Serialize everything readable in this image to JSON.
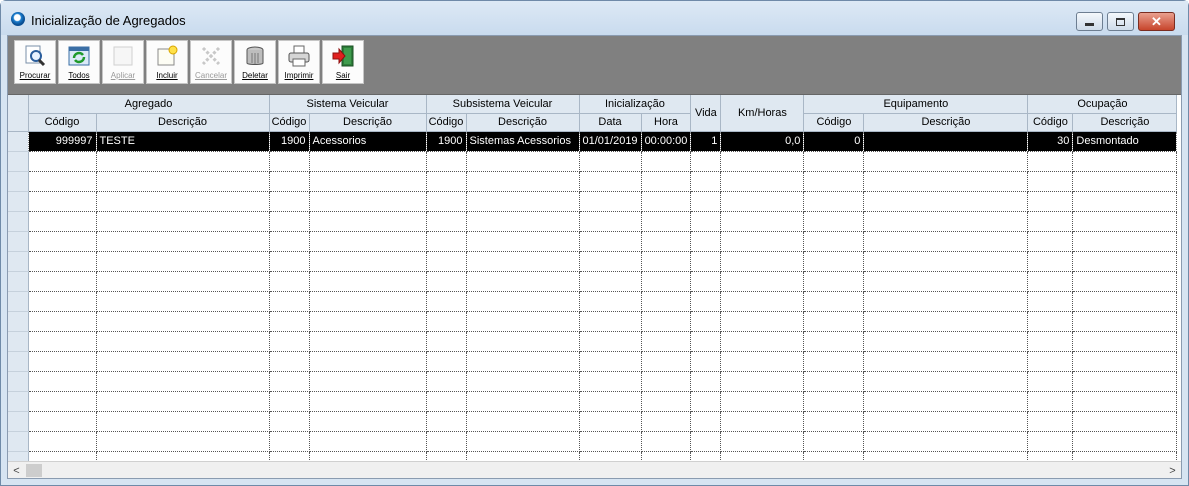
{
  "window": {
    "title": "Inicialização de Agregados"
  },
  "toolbar": {
    "buttons": [
      {
        "label": "Procurar",
        "icon": "magnifier-icon",
        "enabled": true
      },
      {
        "label": "Todos",
        "icon": "refresh-list-icon",
        "enabled": true
      },
      {
        "label": "Aplicar",
        "icon": "apply-icon",
        "enabled": false
      },
      {
        "label": "Incluir",
        "icon": "new-document-icon",
        "enabled": true
      },
      {
        "label": "Cancelar",
        "icon": "cancel-icon",
        "enabled": false
      },
      {
        "label": "Deletar",
        "icon": "trash-can-icon",
        "enabled": true
      },
      {
        "label": "Imprimir",
        "icon": "printer-icon",
        "enabled": true
      },
      {
        "label": "Sair",
        "icon": "exit-door-icon",
        "enabled": true
      }
    ]
  },
  "grid": {
    "groups": {
      "agregado": "Agregado",
      "sistema": "Sistema Veicular",
      "subsistema": "Subsistema Veicular",
      "inicializacao": "Inicialização",
      "vida": "Vida",
      "kmhoras": "Km/Horas",
      "equipamento": "Equipamento",
      "ocupacao": "Ocupação"
    },
    "columns": {
      "codigo": "Código",
      "descricao": "Descrição",
      "data": "Data",
      "hora": "Hora"
    },
    "rows": [
      {
        "ag_codigo": "999997",
        "ag_descricao": "TESTE",
        "sis_codigo": "1900",
        "sis_descricao": "Acessorios",
        "sub_codigo": "1900",
        "sub_descricao": "Sistemas Acessorios",
        "data": "01/01/2019",
        "hora": "00:00:00",
        "vida": "1",
        "kmhoras": "0,0",
        "eq_codigo": "0",
        "eq_descricao": "",
        "oc_codigo": "30",
        "oc_descricao": "Desmontado"
      }
    ],
    "empty_rows": 16
  },
  "scrollbar": {
    "left_arrow": "<",
    "right_arrow": ">"
  }
}
